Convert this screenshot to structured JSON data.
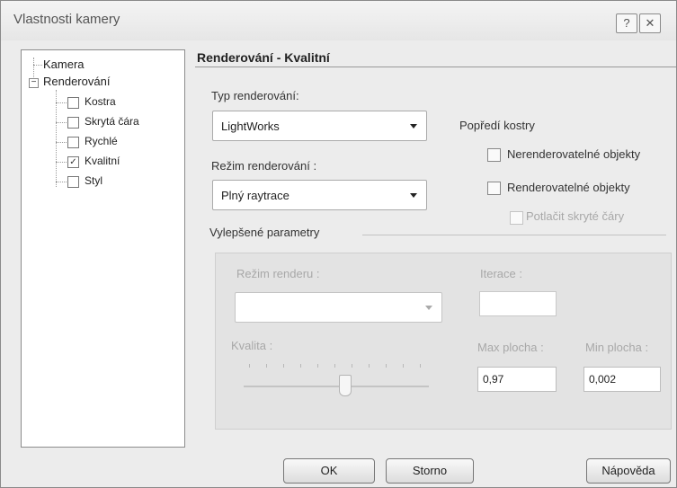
{
  "window": {
    "title": "Vlastnosti kamery",
    "help_glyph": "?",
    "close_glyph": "✕"
  },
  "tree": {
    "root_items": [
      {
        "label": "Kamera"
      },
      {
        "label": "Renderování",
        "expanded": true,
        "expander": "−"
      }
    ],
    "children": [
      {
        "label": "Kostra",
        "checked": false
      },
      {
        "label": "Skrytá čára",
        "checked": false
      },
      {
        "label": "Rychlé",
        "checked": false
      },
      {
        "label": "Kvalitní",
        "checked": true
      },
      {
        "label": "Styl",
        "checked": false
      }
    ],
    "check_glyph": "✓"
  },
  "panel": {
    "header": "Renderování - Kvalitní",
    "render_type": {
      "label": "Typ renderování:",
      "value": "LightWorks"
    },
    "render_mode": {
      "label": "Režim renderování :",
      "value": "Plný raytrace"
    },
    "foreground": {
      "label": "Popředí kostry",
      "options": [
        {
          "label": "Nerenderovatelné objekty",
          "checked": false,
          "enabled": true
        },
        {
          "label": "Renderovatelné objekty",
          "checked": false,
          "enabled": true
        },
        {
          "label": "Potlačit skryté čáry",
          "checked": false,
          "enabled": false
        }
      ]
    },
    "advanced": {
      "label": "Vylepšené parametry",
      "render_mode": {
        "label": "Režim renderu :",
        "value": ""
      },
      "iterations": {
        "label": "Iterace :",
        "value": ""
      },
      "quality": {
        "label": "Kvalita :",
        "level": 0.55
      },
      "max_area": {
        "label": "Max plocha :",
        "value": "0,97"
      },
      "min_area": {
        "label": "Min plocha :",
        "value": "0,002"
      }
    }
  },
  "buttons": {
    "ok": "OK",
    "cancel": "Storno",
    "help": "Nápověda"
  }
}
